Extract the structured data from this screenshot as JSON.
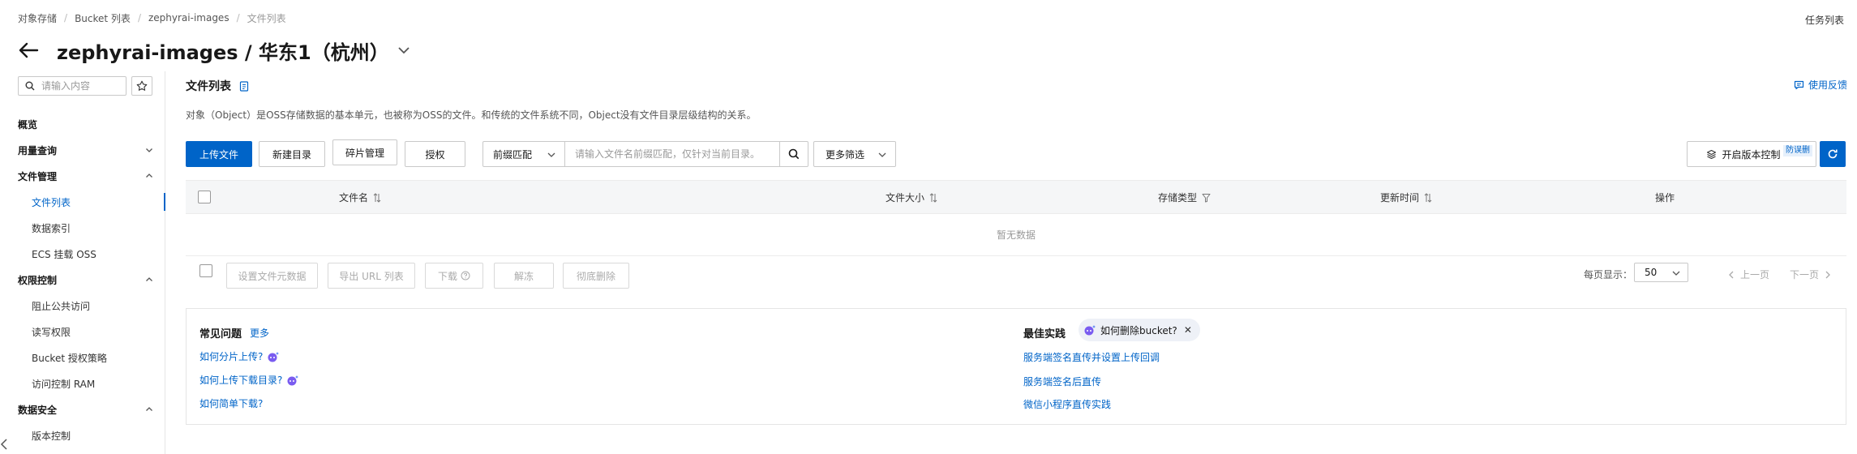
{
  "breadcrumb": [
    "对象存储",
    "Bucket 列表",
    "zephyrai-images",
    "文件列表"
  ],
  "task_center": "任务列表",
  "page_title": "zephyrai-images / 华东1（杭州）",
  "sidebar": {
    "search_placeholder": "请输入内容",
    "items": [
      {
        "label": "概览",
        "kind": "group"
      },
      {
        "label": "用量查询",
        "kind": "group"
      },
      {
        "label": "文件管理",
        "kind": "group"
      },
      {
        "label": "文件列表",
        "kind": "sub"
      },
      {
        "label": "数据索引",
        "kind": "sub"
      },
      {
        "label": "ECS 挂载 OSS",
        "kind": "sub"
      },
      {
        "label": "权限控制",
        "kind": "group"
      },
      {
        "label": "阻止公共访问",
        "kind": "sub"
      },
      {
        "label": "读写权限",
        "kind": "sub"
      },
      {
        "label": "Bucket 授权策略",
        "kind": "sub"
      },
      {
        "label": "访问控制 RAM",
        "kind": "sub"
      },
      {
        "label": "数据安全",
        "kind": "group"
      },
      {
        "label": "版本控制",
        "kind": "sub"
      }
    ]
  },
  "main": {
    "section_title": "文件列表",
    "feedback": "使用反馈",
    "description": "对象（Object）是OSS存储数据的基本单元，也被称为OSS的文件。和传统的文件系统不同，Object没有文件目录层级结构的关系。",
    "toolbar": {
      "upload": "上传文件",
      "new_dir": "新建目录",
      "fragments": "碎片管理",
      "authorize": "授权",
      "prefix_match": "前缀匹配",
      "search_placeholder": "请输入文件名前缀匹配，仅针对当前目录。",
      "more_filter": "更多筛选",
      "version_control": "开启版本控制",
      "version_badge": "防误删"
    },
    "table": {
      "columns": [
        "文件名",
        "文件大小",
        "存储类型",
        "更新时间",
        "操作"
      ],
      "empty": "暂无数据"
    },
    "batch": {
      "set_meta": "设置文件元数据",
      "export_url": "导出 URL 列表",
      "download": "下载",
      "unfreeze": "解冻",
      "delete": "彻底删除"
    },
    "pagination": {
      "page_size_label": "每页显示：",
      "page_size": "50",
      "prev": "上一页",
      "next": "下一页"
    }
  },
  "faq": {
    "title": "常见问题",
    "more": "更多",
    "questions": [
      "如何分片上传?",
      "如何上传下载目录?",
      "如何简单下载?"
    ]
  },
  "best_practice": {
    "title": "最佳实践",
    "chip": "如何删除bucket?",
    "links": [
      "服务端签名直传并设置上传回调",
      "服务端签名后直传",
      "微信小程序直传实践"
    ]
  }
}
